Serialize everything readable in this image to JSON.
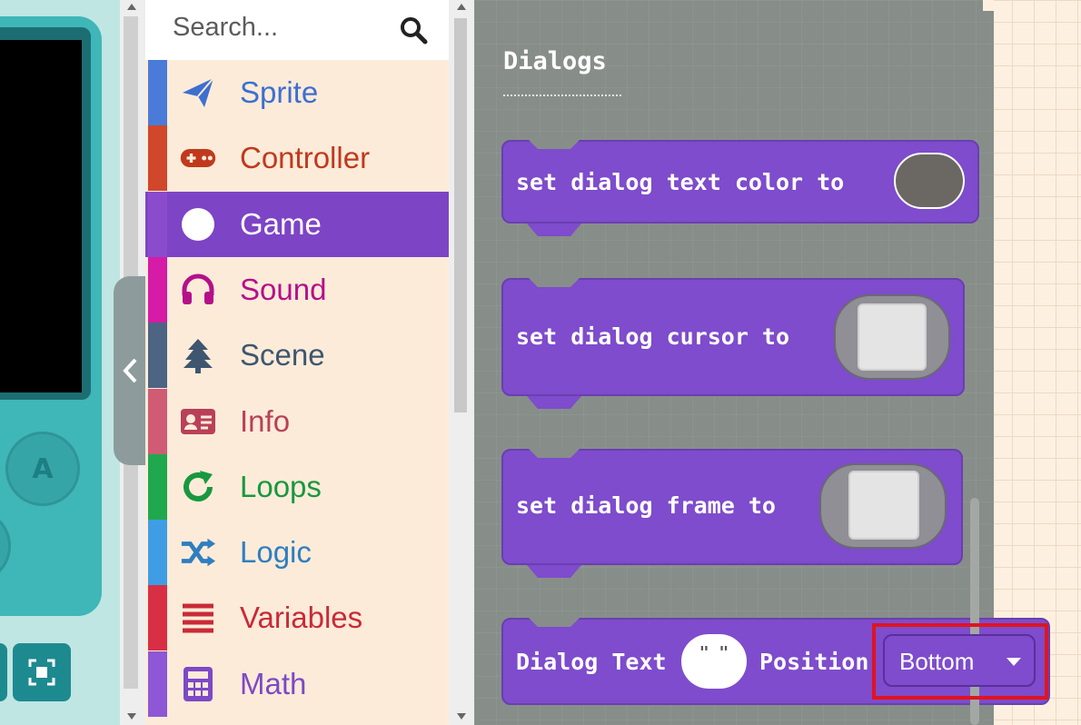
{
  "search": {
    "placeholder": "Search...",
    "icon": "search-icon"
  },
  "categories": [
    {
      "label": "Sprite",
      "color": "#4a7bd8",
      "text_color": "#3d6fd0",
      "icon": "paper-plane-icon"
    },
    {
      "label": "Controller",
      "color": "#d1472b",
      "text_color": "#c0391d",
      "icon": "gamepad-icon"
    },
    {
      "label": "Game",
      "color": "#8a4ccd",
      "text_color": "#ffffff",
      "icon": "circle-icon",
      "selected": true
    },
    {
      "label": "Sound",
      "color": "#d61ba6",
      "text_color": "#b5108a",
      "icon": "headphones-icon"
    },
    {
      "label": "Scene",
      "color": "#4d6483",
      "text_color": "#3e566f",
      "icon": "tree-icon"
    },
    {
      "label": "Info",
      "color": "#cf5c74",
      "text_color": "#b94058",
      "icon": "id-card-icon"
    },
    {
      "label": "Loops",
      "color": "#20a84e",
      "text_color": "#18983f",
      "icon": "refresh-icon"
    },
    {
      "label": "Logic",
      "color": "#3f9ee3",
      "text_color": "#2f7ec0",
      "icon": "shuffle-icon"
    },
    {
      "label": "Variables",
      "color": "#d92f45",
      "text_color": "#c92a38",
      "icon": "list-icon"
    },
    {
      "label": "Math",
      "color": "#8d57d6",
      "text_color": "#7d49c6",
      "icon": "calculator-icon"
    }
  ],
  "simulator": {
    "button_a_label": "A",
    "fullscreen_icon": "fullscreen-icon",
    "collapse_icon": "chevron-left-icon"
  },
  "flyout": {
    "title": "Dialogs",
    "blocks": [
      {
        "text": "set dialog text color to",
        "input": "color-swatch-oval"
      },
      {
        "text": "set dialog cursor to",
        "input": "image-swatch"
      },
      {
        "text": "set dialog frame to",
        "input": "image-swatch"
      },
      {
        "text_prefix": "Dialog Text",
        "text_suffix": "Position",
        "string_input": "\" \"",
        "dropdown_value": "Bottom"
      }
    ]
  },
  "colors": {
    "block_purple": "#7e4ccc",
    "flyout_bg": "#878e8a",
    "highlight": "#e0141e"
  }
}
